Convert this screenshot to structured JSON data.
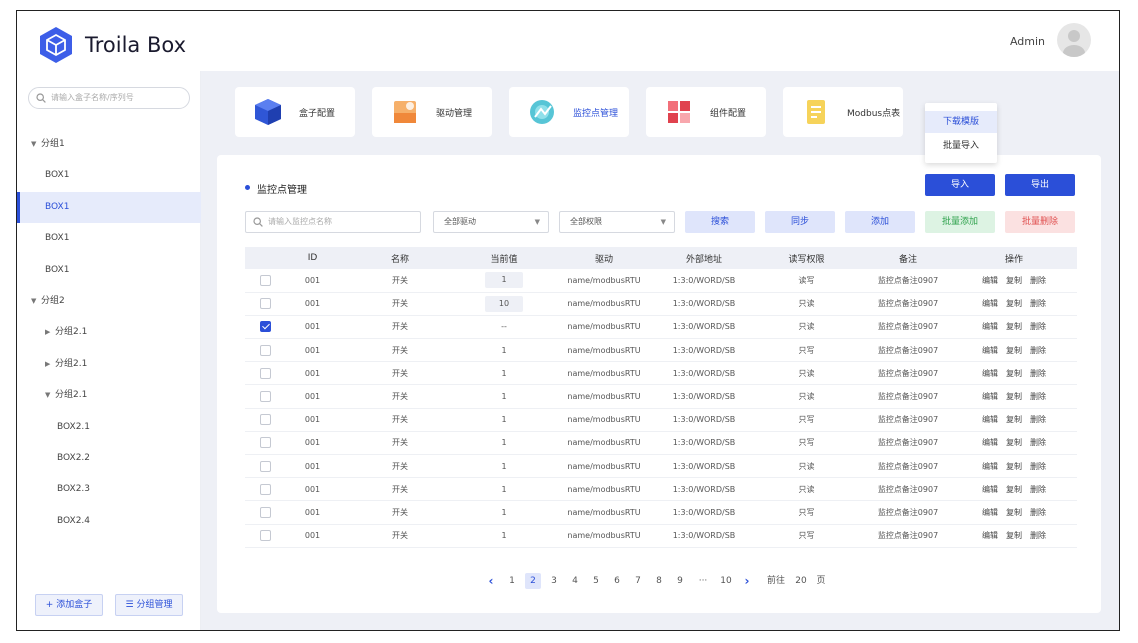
{
  "header": {
    "brand": "Troila Box",
    "user": "Admin"
  },
  "sidebar": {
    "search_placeholder": "请输入盒子名称/序列号",
    "tree": [
      {
        "label": "分组1",
        "type": "group",
        "expanded": true
      },
      {
        "label": "BOX1",
        "type": "box"
      },
      {
        "label": "BOX1",
        "type": "box",
        "active": true
      },
      {
        "label": "BOX1",
        "type": "box"
      },
      {
        "label": "BOX1",
        "type": "box"
      },
      {
        "label": "分组2",
        "type": "group",
        "expanded": true
      },
      {
        "label": "分组2.1",
        "type": "subgroup",
        "expanded": false
      },
      {
        "label": "分组2.1",
        "type": "subgroup",
        "expanded": false
      },
      {
        "label": "分组2.1",
        "type": "subgroup",
        "expanded": true
      },
      {
        "label": "BOX2.1",
        "type": "subbox"
      },
      {
        "label": "BOX2.2",
        "type": "subbox"
      },
      {
        "label": "BOX2.3",
        "type": "subbox"
      },
      {
        "label": "BOX2.4",
        "type": "subbox"
      }
    ],
    "add_box": "+ 添加盒子",
    "group_manage": "☰ 分组管理"
  },
  "modules": [
    {
      "label": "盒子配置",
      "icon": "box-config-icon"
    },
    {
      "label": "驱动管理",
      "icon": "driver-icon"
    },
    {
      "label": "监控点管理",
      "icon": "monitor-icon",
      "active": true
    },
    {
      "label": "组件配置",
      "icon": "component-icon"
    },
    {
      "label": "Modbus点表",
      "icon": "modbus-icon"
    }
  ],
  "import_menu": {
    "items": [
      "下载模版",
      "批量导入"
    ]
  },
  "panel": {
    "title": "监控点管理",
    "import": "导入",
    "export": "导出",
    "search_placeholder": "请输入监控点名称",
    "driver_filter": "全部驱动",
    "permission_filter": "全部权限",
    "search": "搜索",
    "sync": "同步",
    "add": "添加",
    "batch_add": "批量添加",
    "batch_delete": "批量删除"
  },
  "table": {
    "headers": [
      "ID",
      "名称",
      "当前值",
      "驱动",
      "外部地址",
      "读写权限",
      "备注",
      "操作"
    ],
    "ops": [
      "编辑",
      "复制",
      "删除"
    ],
    "rows": [
      {
        "checked": false,
        "id": "001",
        "name": "开关",
        "value": "1",
        "boxed": true,
        "driver": "name/modbusRTU",
        "addr": "1:3:0/WORD/SB",
        "perm": "读写",
        "note": "监控点备注0907"
      },
      {
        "checked": false,
        "id": "001",
        "name": "开关",
        "value": "10",
        "boxed": true,
        "driver": "name/modbusRTU",
        "addr": "1:3:0/WORD/SB",
        "perm": "只读",
        "note": "监控点备注0907"
      },
      {
        "checked": true,
        "id": "001",
        "name": "开关",
        "value": "--",
        "boxed": false,
        "driver": "name/modbusRTU",
        "addr": "1:3:0/WORD/SB",
        "perm": "只读",
        "note": "监控点备注0907"
      },
      {
        "checked": false,
        "id": "001",
        "name": "开关",
        "value": "1",
        "boxed": false,
        "driver": "name/modbusRTU",
        "addr": "1:3:0/WORD/SB",
        "perm": "只写",
        "note": "监控点备注0907"
      },
      {
        "checked": false,
        "id": "001",
        "name": "开关",
        "value": "1",
        "boxed": false,
        "driver": "name/modbusRTU",
        "addr": "1:3:0/WORD/SB",
        "perm": "只读",
        "note": "监控点备注0907"
      },
      {
        "checked": false,
        "id": "001",
        "name": "开关",
        "value": "1",
        "boxed": false,
        "driver": "name/modbusRTU",
        "addr": "1:3:0/WORD/SB",
        "perm": "只读",
        "note": "监控点备注0907"
      },
      {
        "checked": false,
        "id": "001",
        "name": "开关",
        "value": "1",
        "boxed": false,
        "driver": "name/modbusRTU",
        "addr": "1:3:0/WORD/SB",
        "perm": "只写",
        "note": "监控点备注0907"
      },
      {
        "checked": false,
        "id": "001",
        "name": "开关",
        "value": "1",
        "boxed": false,
        "driver": "name/modbusRTU",
        "addr": "1:3:0/WORD/SB",
        "perm": "只写",
        "note": "监控点备注0907"
      },
      {
        "checked": false,
        "id": "001",
        "name": "开关",
        "value": "1",
        "boxed": false,
        "driver": "name/modbusRTU",
        "addr": "1:3:0/WORD/SB",
        "perm": "只读",
        "note": "监控点备注0907"
      },
      {
        "checked": false,
        "id": "001",
        "name": "开关",
        "value": "1",
        "boxed": false,
        "driver": "name/modbusRTU",
        "addr": "1:3:0/WORD/SB",
        "perm": "只读",
        "note": "监控点备注0907"
      },
      {
        "checked": false,
        "id": "001",
        "name": "开关",
        "value": "1",
        "boxed": false,
        "driver": "name/modbusRTU",
        "addr": "1:3:0/WORD/SB",
        "perm": "只写",
        "note": "监控点备注0907"
      },
      {
        "checked": false,
        "id": "001",
        "name": "开关",
        "value": "1",
        "boxed": false,
        "driver": "name/modbusRTU",
        "addr": "1:3:0/WORD/SB",
        "perm": "只写",
        "note": "监控点备注0907"
      }
    ]
  },
  "pagination": {
    "prev": "‹",
    "pages": [
      "1",
      "2",
      "3",
      "4",
      "5",
      "6",
      "7",
      "8",
      "9",
      "···",
      "10"
    ],
    "current": "2",
    "next": "›",
    "goto_label": "前往",
    "goto_value": "20",
    "page_unit": "页"
  },
  "colors": {
    "primary": "#2b4fd8",
    "bg": "#eef0f6"
  }
}
